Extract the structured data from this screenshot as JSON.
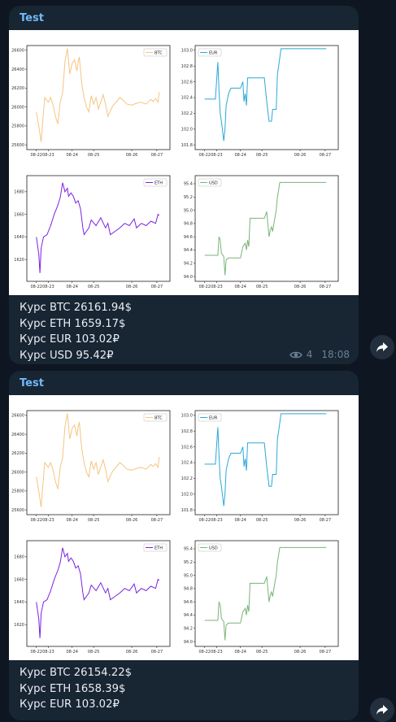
{
  "messages": [
    {
      "sender": "Test",
      "caption": [
        "Курс BTC 26161.94$",
        "Курс ETH 1659.17$",
        "Курс EUR 103.02₽",
        "Курс USD 95.42₽"
      ],
      "views": "4",
      "time": "18:08"
    },
    {
      "sender": "Test",
      "caption": [
        "Курс BTC 26154.22$",
        "Курс ETH 1658.39$",
        "Курс EUR 103.02₽"
      ]
    }
  ],
  "chart_data": [
    {
      "type": "line",
      "series": [
        {
          "name": "BTC",
          "color": "#f5c581"
        }
      ],
      "x_ticks": [
        "08-22",
        "08-23",
        "08-24",
        "08-25",
        "08-26",
        "08-27"
      ],
      "y_ticks": [
        "26600",
        "26400",
        "26200",
        "26000",
        "25800",
        "25600"
      ],
      "ylim": [
        25600,
        26600
      ],
      "x": [
        0,
        0.1,
        0.2,
        0.25,
        0.35,
        0.5,
        0.6,
        0.7,
        0.8,
        0.9,
        1.0,
        1.1,
        1.2,
        1.3,
        1.4,
        1.5,
        1.6,
        1.7,
        1.75,
        1.8,
        1.9,
        2.0,
        2.1,
        2.2,
        2.3,
        2.4,
        2.5,
        2.6,
        2.7,
        2.8,
        2.9,
        3.0,
        3.1,
        3.2,
        3.3,
        3.4,
        3.5,
        3.6,
        3.8,
        4.0,
        4.2,
        4.4,
        4.6,
        4.8,
        4.9,
        5.0,
        5.1,
        5.15
      ],
      "y": [
        25950,
        25800,
        25630,
        25800,
        26100,
        26050,
        26100,
        26020,
        25900,
        25820,
        26050,
        26150,
        26480,
        26620,
        26350,
        26460,
        26500,
        26380,
        26480,
        26530,
        26250,
        26100,
        26000,
        25950,
        26120,
        26030,
        26100,
        25980,
        26050,
        26130,
        26030,
        25900,
        25960,
        26010,
        26040,
        26070,
        26100,
        26080,
        26030,
        26020,
        26040,
        26050,
        26030,
        26080,
        26060,
        26090,
        26050,
        26160
      ]
    },
    {
      "type": "line",
      "series": [
        {
          "name": "EUR",
          "color": "#2aa8d8"
        }
      ],
      "x_ticks": [
        "08-22",
        "08-23",
        "08-24",
        "08-25",
        "08-26",
        "08-27"
      ],
      "y_ticks": [
        "103.0",
        "102.8",
        "102.6",
        "102.4",
        "102.2",
        "102.0",
        "101.8"
      ],
      "ylim": [
        101.8,
        103.0
      ],
      "x": [
        0,
        0.3,
        0.45,
        0.55,
        0.6,
        0.65,
        0.7,
        0.8,
        0.85,
        0.9,
        1.0,
        1.1,
        1.2,
        1.5,
        1.6,
        1.65,
        1.7,
        1.75,
        1.8,
        1.9,
        2.0,
        2.5,
        2.6,
        2.7,
        2.8,
        2.85,
        2.9,
        3.0,
        3.05,
        3.1,
        3.2,
        3.3,
        3.4,
        4.0,
        4.5,
        5.1
      ],
      "y": [
        102.38,
        102.38,
        102.38,
        102.85,
        102.5,
        102.2,
        102.1,
        101.85,
        102.0,
        102.3,
        102.45,
        102.52,
        102.52,
        102.52,
        102.6,
        102.35,
        102.45,
        102.3,
        102.65,
        102.65,
        102.65,
        102.65,
        102.35,
        102.1,
        102.1,
        102.25,
        102.25,
        102.25,
        102.7,
        102.8,
        103.02,
        103.02,
        103.02,
        103.02,
        103.02,
        103.02
      ]
    },
    {
      "type": "line",
      "series": [
        {
          "name": "ETH",
          "color": "#7b22e0"
        }
      ],
      "x_ticks": [
        "08-22",
        "08-23",
        "08-24",
        "08-25",
        "08-26",
        "08-27"
      ],
      "y_ticks": [
        "1680",
        "1660",
        "1640",
        "1620"
      ],
      "ylim": [
        1605,
        1690
      ],
      "x": [
        0,
        0.1,
        0.15,
        0.2,
        0.3,
        0.45,
        0.6,
        0.75,
        0.9,
        1.0,
        1.1,
        1.2,
        1.3,
        1.35,
        1.45,
        1.55,
        1.65,
        1.75,
        1.85,
        1.95,
        2.0,
        2.1,
        2.2,
        2.3,
        2.5,
        2.7,
        2.9,
        3.0,
        3.1,
        3.3,
        3.5,
        3.7,
        3.9,
        4.1,
        4.2,
        4.4,
        4.6,
        4.8,
        5.0,
        5.1,
        5.15
      ],
      "y": [
        1640,
        1625,
        1608,
        1630,
        1640,
        1642,
        1650,
        1660,
        1668,
        1675,
        1688,
        1680,
        1683,
        1676,
        1679,
        1676,
        1670,
        1672,
        1665,
        1648,
        1642,
        1645,
        1648,
        1655,
        1650,
        1657,
        1648,
        1652,
        1642,
        1645,
        1648,
        1652,
        1650,
        1656,
        1648,
        1652,
        1650,
        1654,
        1652,
        1660,
        1659
      ]
    },
    {
      "type": "line",
      "series": [
        {
          "name": "USD",
          "color": "#7ab37a"
        }
      ],
      "x_ticks": [
        "08-22",
        "08-23",
        "08-24",
        "08-25",
        "08-26",
        "08-27"
      ],
      "y_ticks": [
        "95.4",
        "95.2",
        "95.0",
        "94.8",
        "94.6",
        "94.4",
        "94.2",
        "94.0"
      ],
      "ylim": [
        94.0,
        95.45
      ],
      "x": [
        0,
        0.4,
        0.55,
        0.6,
        0.65,
        0.7,
        0.8,
        0.85,
        0.9,
        1.0,
        1.5,
        1.6,
        1.7,
        1.75,
        1.8,
        1.85,
        1.9,
        2.0,
        2.5,
        2.6,
        2.7,
        2.75,
        2.8,
        2.85,
        2.9,
        3.0,
        3.05,
        3.15,
        3.3,
        4.0,
        4.5,
        5.1
      ],
      "y": [
        94.32,
        94.32,
        94.32,
        94.6,
        94.55,
        94.35,
        94.3,
        94.02,
        94.25,
        94.28,
        94.28,
        94.45,
        94.5,
        94.4,
        94.55,
        94.45,
        94.88,
        94.88,
        94.88,
        94.98,
        94.6,
        94.7,
        94.75,
        94.68,
        94.8,
        95.0,
        95.2,
        95.42,
        95.42,
        95.42,
        95.42,
        95.42
      ]
    }
  ]
}
